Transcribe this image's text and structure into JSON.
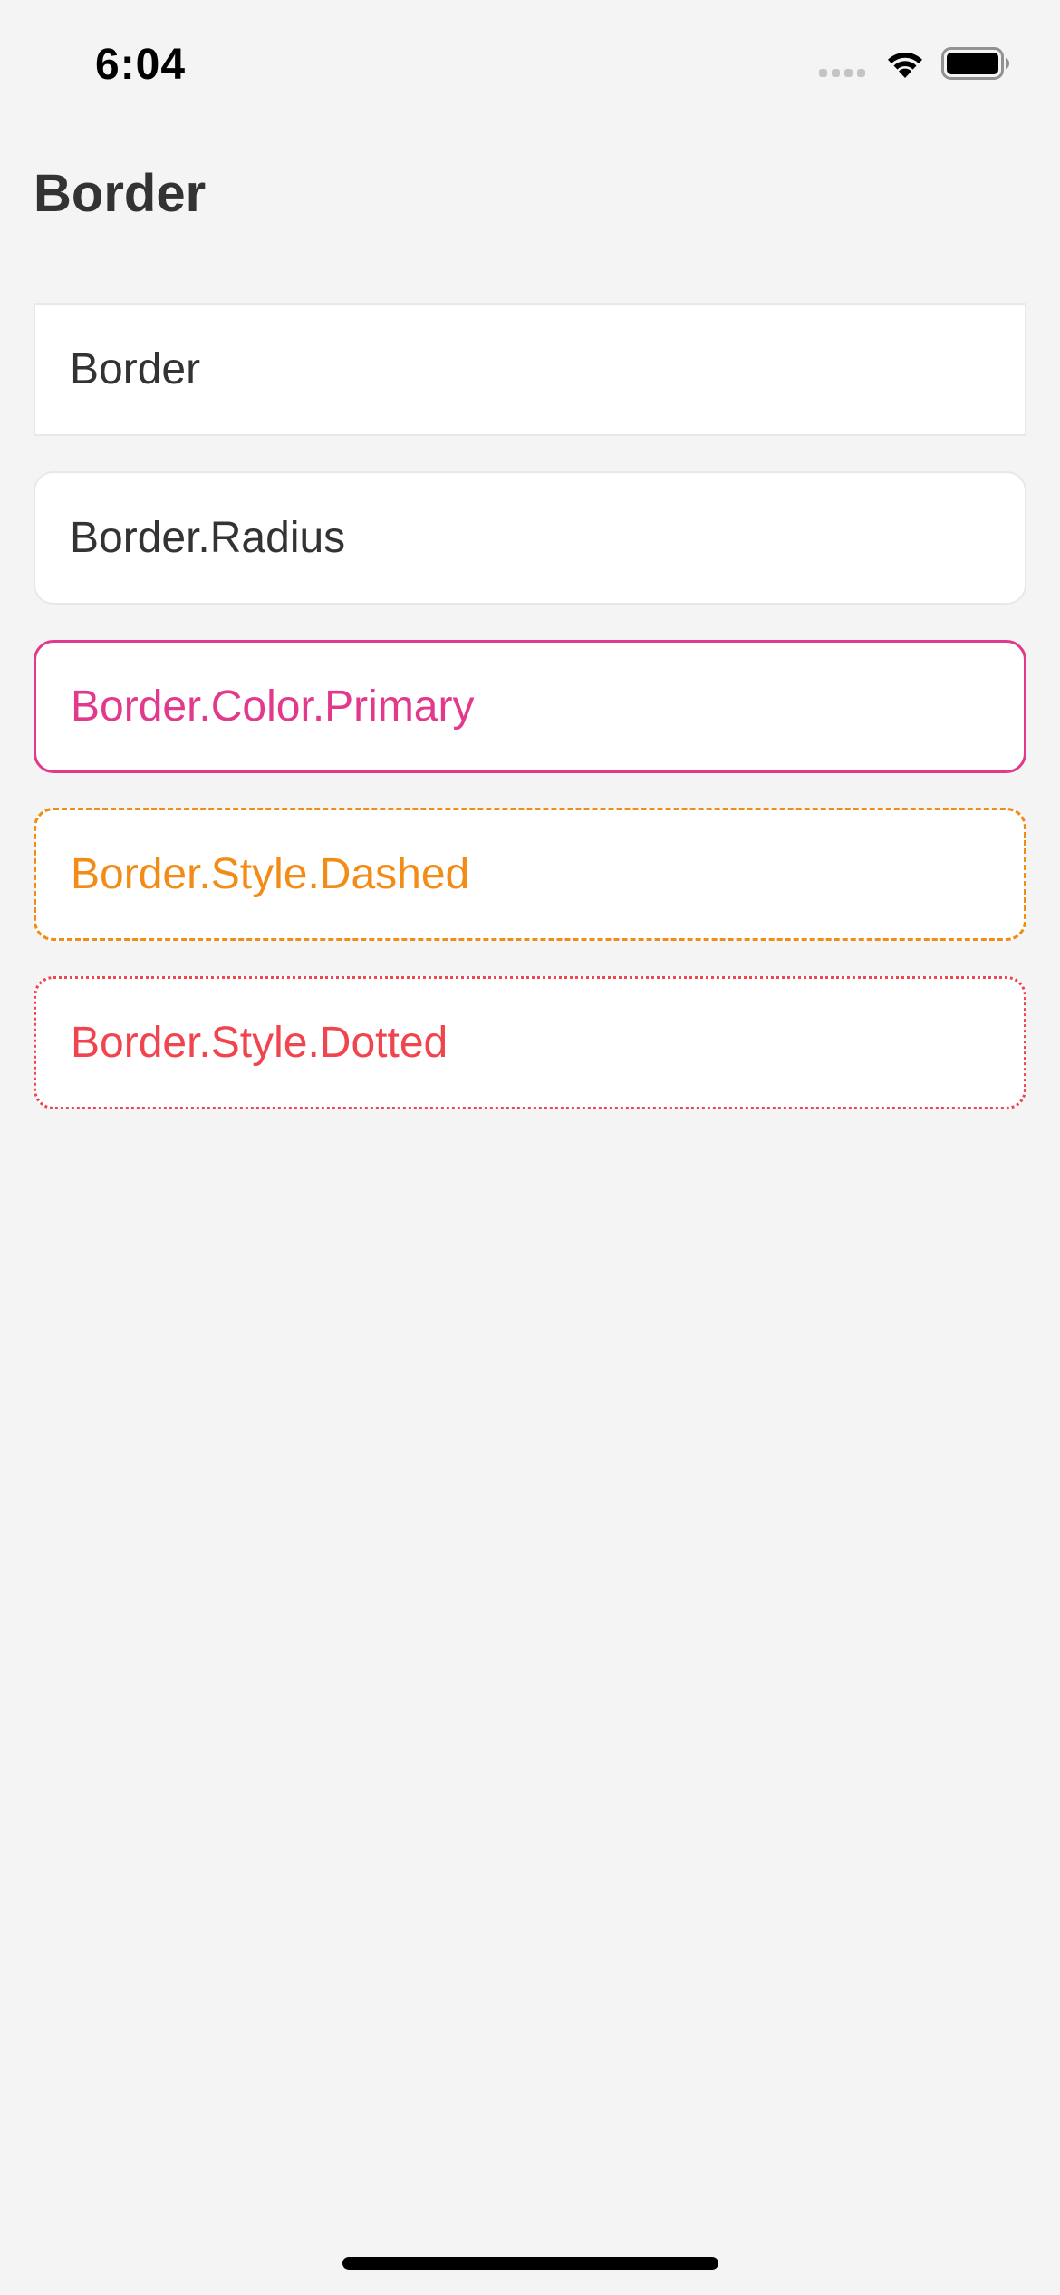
{
  "status_bar": {
    "time": "6:04",
    "icons": [
      "cellular-signal-icon",
      "wifi-icon",
      "battery-icon"
    ]
  },
  "page": {
    "title": "Border"
  },
  "cells": [
    {
      "label": "Border",
      "border_color": "#e8e8e8",
      "text_color": "#333333",
      "border_style": "solid"
    },
    {
      "label": "Border.Radius",
      "border_color": "#e8e8e8",
      "text_color": "#333333",
      "border_style": "solid"
    },
    {
      "label": "Border.Color.Primary",
      "border_color": "#e2398d",
      "text_color": "#e2398d",
      "border_style": "solid"
    },
    {
      "label": "Border.Style.Dashed",
      "border_color": "#f28c16",
      "text_color": "#f28c16",
      "border_style": "dashed"
    },
    {
      "label": "Border.Style.Dotted",
      "border_color": "#f0454f",
      "text_color": "#f0454f",
      "border_style": "dotted"
    }
  ],
  "colors": {
    "background": "#f4f4f4",
    "primary": "#e2398d",
    "warning": "#f28c16",
    "danger": "#f0454f"
  }
}
